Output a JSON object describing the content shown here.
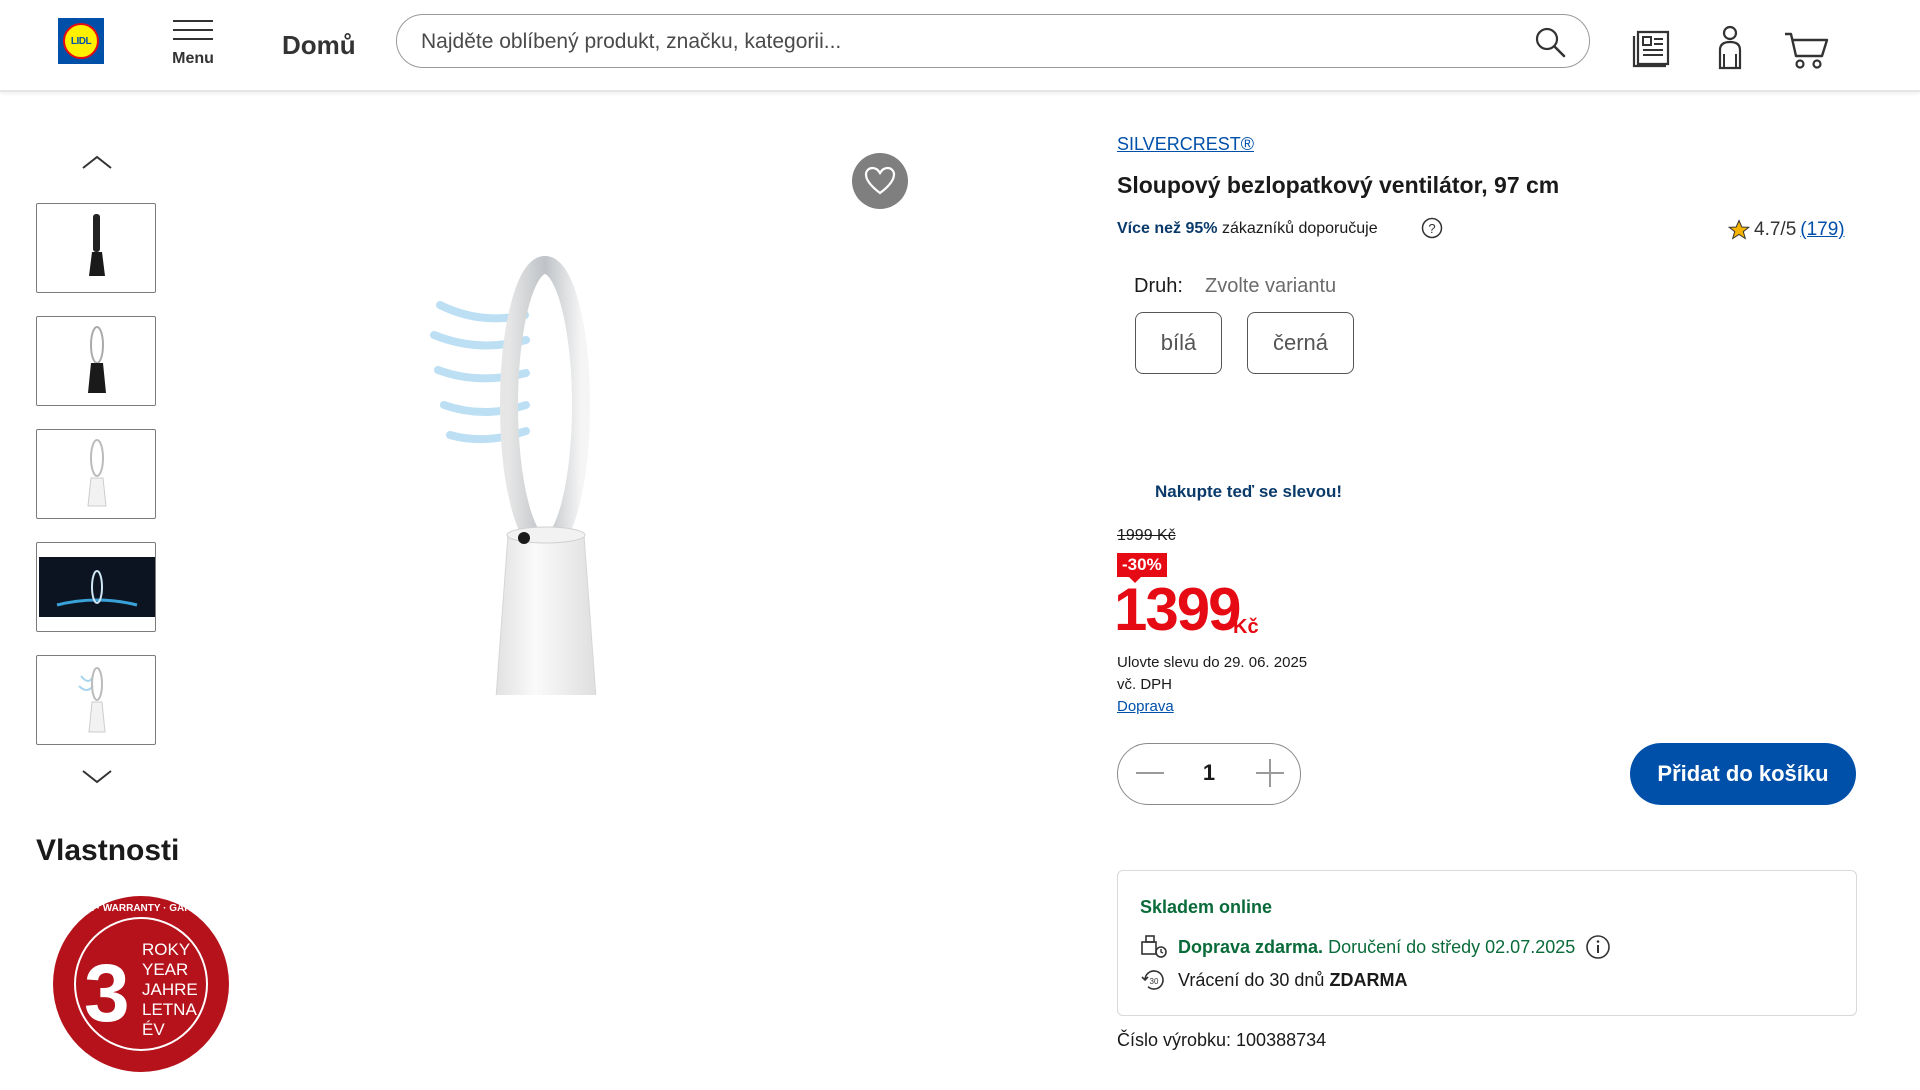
{
  "header": {
    "logo_text": "LIDL",
    "menu_label": "Menu",
    "home_label": "Domů",
    "search_placeholder": "Najděte oblíbený produkt, značku, kategorii..."
  },
  "gallery": {
    "thumbnail_count": 5
  },
  "features": {
    "title": "Vlastnosti",
    "warranty_badge": {
      "number": "3",
      "lines": [
        "ROKY",
        "YEAR",
        "JAHRE",
        "LETNA",
        "ÉV"
      ],
      "ring_text": "ZÁRUKA · GARANTIE · WARRANTY · GARANCIA · GARANCIJA"
    }
  },
  "product": {
    "brand": "SILVERCREST®",
    "title": "Sloupový bezlopatkový ventilátor, 97 cm",
    "recommend_bold": "Více než 95%",
    "recommend_rest": "zákazníků doporučuje",
    "rating": "4.7/5",
    "rating_count": "(179)",
    "variant_label": "Druh:",
    "variant_prompt": "Zvolte variantu",
    "variants": [
      "bílá",
      "černá"
    ],
    "promo_text": "Nakupte teď se slevou!",
    "old_price": "1999 Kč",
    "discount": "-30%",
    "price": "1399",
    "currency": "Kč",
    "sale_until": "Ulovte slevu do 29. 06. 2025",
    "vat": "vč. DPH",
    "shipping_link": "Doprava",
    "quantity": "1",
    "add_to_cart": "Přidat do košíku",
    "stock_status": "Skladem online",
    "free_shipping": "Doprava zdarma.",
    "delivery": "Doručení do středy 02.07.2025",
    "return_text": "Vrácení do 30 dnů",
    "return_free": "ZDARMA",
    "sku": "Číslo výrobku: 100388734"
  },
  "colors": {
    "brand_blue": "#0050aa",
    "price_red": "#e60a14",
    "stock_green": "#0a6b3a"
  }
}
